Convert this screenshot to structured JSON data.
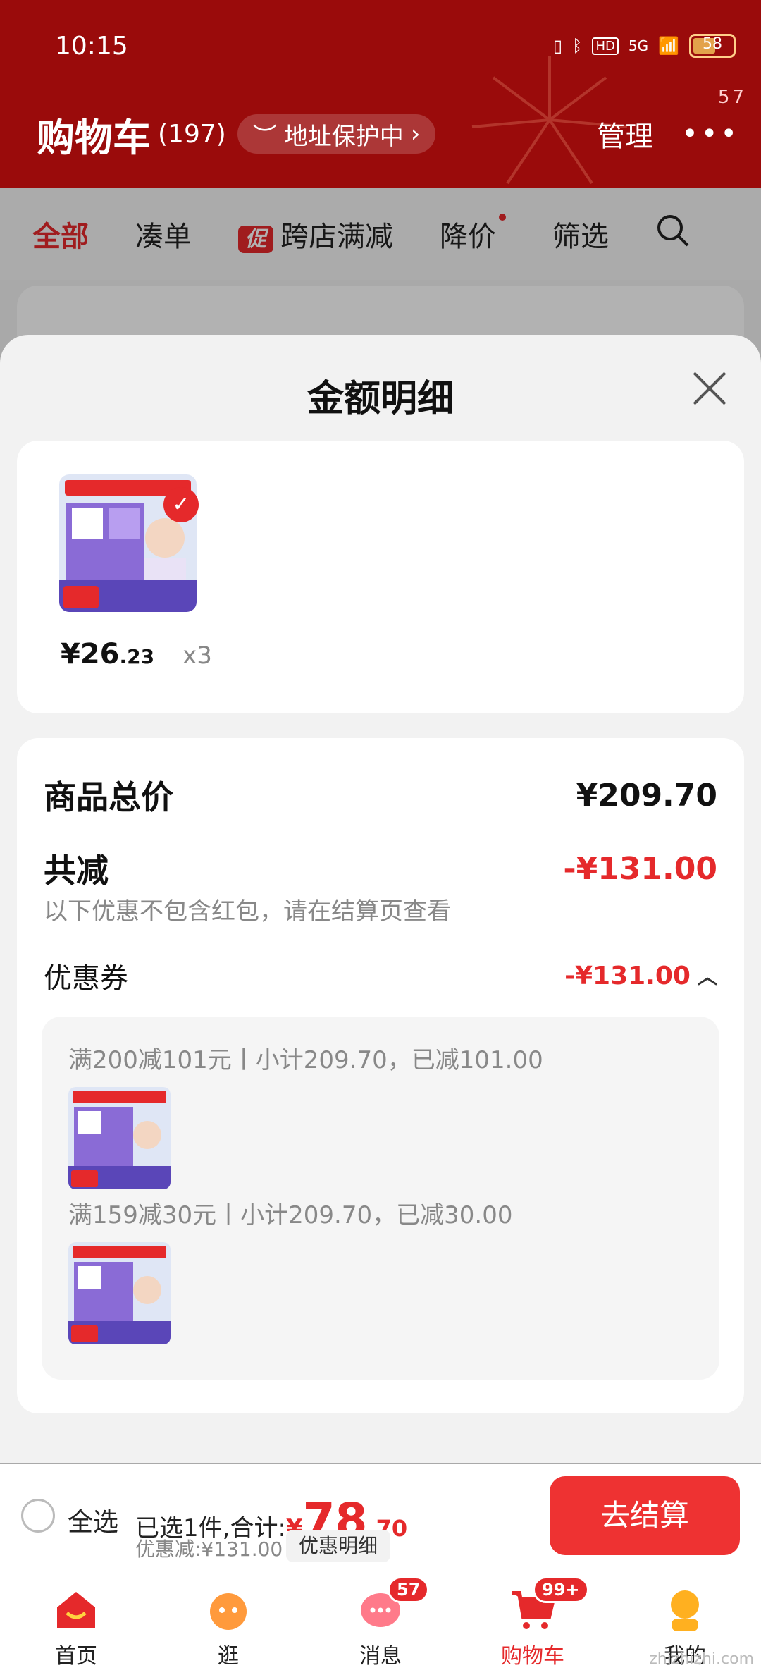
{
  "status_bar": {
    "time": "10:15",
    "battery": "58",
    "network": "5G",
    "hd": "HD"
  },
  "header": {
    "title": "购物车",
    "count": "(197)",
    "address_pill": "地址保护中",
    "manage": "管理",
    "more_badge": "57"
  },
  "tabs": {
    "all": "全部",
    "bundle": "凑单",
    "promo_chip": "促",
    "cross_store": "跨店满减",
    "price_drop": "降价",
    "filter": "筛选"
  },
  "sheet": {
    "title": "金额明细",
    "item": {
      "price_int": "¥26",
      "price_dec": ".23",
      "qty": "x3"
    },
    "goods_total_label": "商品总价",
    "goods_total_value": "¥209.70",
    "reduced_label": "共减",
    "reduced_value": "-¥131.00",
    "note": "以下优惠不包含红包，请在结算页查看",
    "coupon_label": "优惠券",
    "coupon_value": "-¥131.00",
    "coupons": [
      {
        "text": "满200减101元丨小计209.70，已减101.00"
      },
      {
        "text": "满159减30元丨小计209.70，已减30.00"
      }
    ]
  },
  "checkout": {
    "select_all": "全选",
    "selected_prefix": "已选1件,合计:",
    "currency": "¥",
    "total_int": "78",
    "total_dec": ".70",
    "discount": "优惠减:¥131.00",
    "detail": "优惠明细",
    "button": "去结算"
  },
  "nav": {
    "home": "首页",
    "browse": "逛",
    "messages": "消息",
    "messages_badge": "57",
    "cart": "购物车",
    "cart_badge": "99+",
    "me": "我的"
  },
  "watermark": "zhizhizhi.com",
  "colors": {
    "header_bg": "#9a0b0b",
    "accent_red": "#e5292b",
    "sheet_bg": "#f2f2f2"
  }
}
